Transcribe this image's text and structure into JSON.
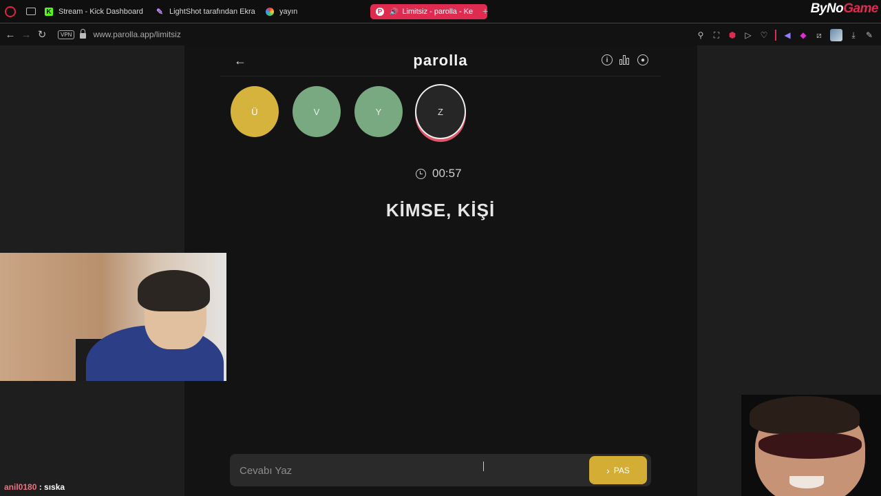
{
  "browser": {
    "tabs": [
      {
        "label": "Stream - Kick Dashboard",
        "icon": "kick-icon"
      },
      {
        "label": "LightShot tarafından Ekra",
        "icon": "lightshot-icon"
      },
      {
        "label": "yayın",
        "icon": "color-wheel-icon"
      },
      {
        "label": "Limitsiz - parolla - Ke",
        "icon": "parolla-icon",
        "active": true
      }
    ],
    "new_tab": "+",
    "brand": {
      "prefix": "ByNo",
      "suffix": "Game"
    },
    "vpn": "VPN",
    "url_host": "www.parolla.app",
    "url_path": "/limitsiz",
    "accent": "#e02b50"
  },
  "app": {
    "title": "parolla",
    "back": "←",
    "info_icon": "i"
  },
  "letters": [
    {
      "letter": "Ü",
      "state": "yellow",
      "color": "#d6b33d"
    },
    {
      "letter": "V",
      "state": "green",
      "color": "#79a980"
    },
    {
      "letter": "Y",
      "state": "green",
      "color": "#79a980"
    },
    {
      "letter": "Z",
      "state": "current",
      "color": "#262626"
    }
  ],
  "timer": "00:57",
  "clue": "KİMSE, KİŞİ",
  "answer": {
    "placeholder": "Cevabı Yaz",
    "pass_label": "PAS",
    "pass_chevron": "›",
    "pass_color": "#d4ad34"
  },
  "chat": {
    "user": "anil0180",
    "separator": " : ",
    "message": "sıska"
  }
}
